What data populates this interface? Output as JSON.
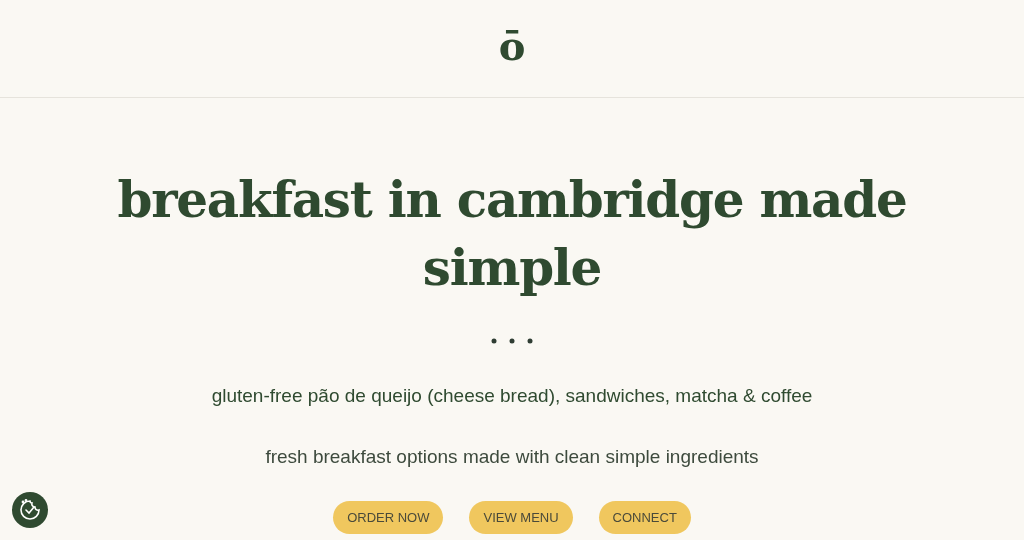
{
  "header": {
    "logo": "ō"
  },
  "hero": {
    "title": "breakfast in cambridge made simple",
    "subtitle": "gluten-free pão de queijo (cheese bread), sandwiches, matcha & coffee",
    "tagline": "fresh breakfast options made with clean simple ingredients",
    "buttons": [
      "ORDER NOW",
      "VIEW MENU",
      "CONNECT"
    ]
  }
}
